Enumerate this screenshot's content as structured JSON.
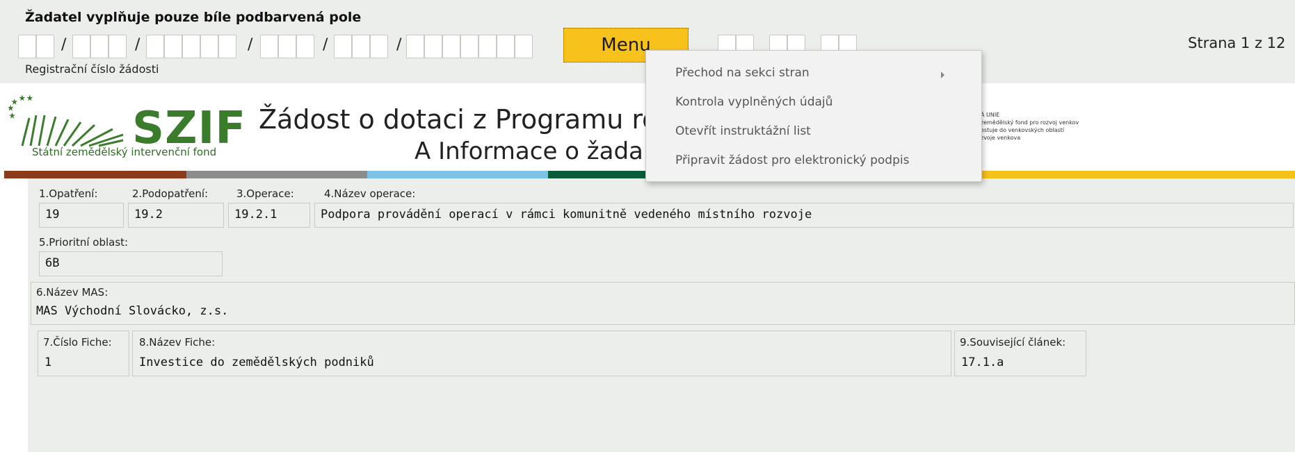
{
  "header": {
    "instruction": "Žadatel vyplňuje pouze bíle podbarvená pole",
    "registration_label": "Registrační číslo žádosti",
    "menu_label": "Menu",
    "page_label": "Strana 1 z 12",
    "slash": "/"
  },
  "logo": {
    "brand": "SZIF",
    "subtitle": "Státní zemědělský intervenční fond"
  },
  "document": {
    "title": "Žádost o dotaci z Programu ro",
    "subtitle": "A Informace o žada"
  },
  "eu_block": {
    "line1": "Á UNIE",
    "line2": "zemědělský fond pro rozvoj venkov",
    "line3": "estuje do venkovských oblastí",
    "line4": "zvoje venkova"
  },
  "menu": {
    "items": [
      {
        "label": "Přechod na sekci stran",
        "has_submenu": true
      },
      {
        "label": "Kontrola vyplněných údajů"
      },
      {
        "label": "Otevřít instruktážní list"
      },
      {
        "label": "Připravit žádost pro elektronický podpis"
      }
    ]
  },
  "form": {
    "opatreni": {
      "label": "1.Opatření:",
      "value": "19"
    },
    "podopatreni": {
      "label": "2.Podopatření:",
      "value": "19.2"
    },
    "operace": {
      "label": "3.Operace:",
      "value": "19.2.1"
    },
    "nazev_operace": {
      "label": "4.Název operace:",
      "value": "Podpora provádění operací v rámci komunitně vedeného místního rozvoje"
    },
    "prioritni_oblast": {
      "label": "5.Prioritní oblast:",
      "value": "6B"
    },
    "nazev_mas": {
      "label": "6.Název MAS:",
      "value": "MAS Východní Slovácko, z.s."
    },
    "cislo_fiche": {
      "label": "7.Číslo Fiche:",
      "value": "1"
    },
    "nazev_fiche": {
      "label": "8.Název Fiche:",
      "value": "Investice do zemědělských podniků"
    },
    "souvisejici_clanek": {
      "label": "9.Související článek:",
      "value": "17.1.a"
    }
  },
  "colors": {
    "menu_button": "#f7c21b",
    "band": [
      "#8b3a1a",
      "#8c8c8c",
      "#7ec3e6",
      "#0a5b3a",
      "#f4c21a"
    ],
    "logo_green": "#3a7c2b"
  }
}
